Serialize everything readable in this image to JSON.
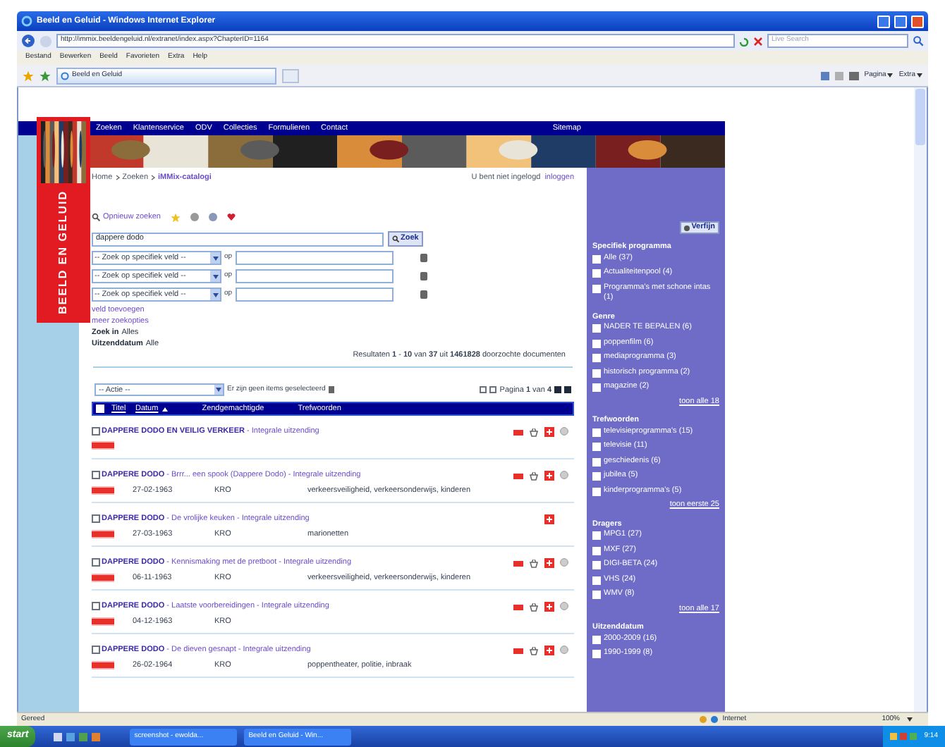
{
  "browser": {
    "title": "Beeld en Geluid - Windows Internet Explorer",
    "address": "http://immix.beeldengeluid.nl/extranet/index.aspx?ChapterID=1164",
    "search_placeholder": "Live Search",
    "menu": [
      "Bestand",
      "Bewerken",
      "Beeld",
      "Favorieten",
      "Extra",
      "Help"
    ],
    "tab": "Beeld en Geluid",
    "tools": [
      "Pagina",
      "Extra"
    ]
  },
  "site": {
    "logo_text": "BEELD EN GELUID",
    "nav": [
      "Zoeken",
      "Klantenservice",
      "ODV",
      "Collecties",
      "Formulieren",
      "Contact"
    ],
    "sitemap": "Sitemap",
    "breadcrumb": [
      "Home",
      "Zoeken",
      "iMMix-catalogi"
    ],
    "login_status": "U bent niet ingelogd",
    "login_link": "inloggen"
  },
  "search": {
    "again": "Opnieuw zoeken",
    "query": "dappere dodo",
    "button": "Zoek",
    "fields": [
      {
        "select": "-- Zoek op specifiek veld --",
        "op": "op"
      },
      {
        "select": "-- Zoek op specifiek veld --",
        "op": "op"
      },
      {
        "select": "-- Zoek op specifiek veld --",
        "op": "op"
      }
    ],
    "links": [
      "veld toevoegen",
      "meer zoekopties"
    ],
    "filters": [
      {
        "label": "Zoek in",
        "value": "Alles"
      },
      {
        "label": "Uitzenddatum",
        "value": "Alle"
      }
    ],
    "summary": "Resultaten **1** - **10** van **37** uit **1461828** doorzochte documenten"
  },
  "actions": {
    "select": "-- Actie --",
    "message": "Er zijn geen items geselecteerd",
    "pager": "Pagina **1** van **4**"
  },
  "table": {
    "select_all_checked": false,
    "columns": [
      "Titel",
      "Datum",
      "Zendgemachtigde",
      "Trefwoorden"
    ],
    "rows": [
      {
        "title": "DAPPERE DODO EN VEILIG VERKEER",
        "subtitle": "- Integrale uitzending",
        "checked": false,
        "preview": true,
        "basket": true,
        "add": true,
        "info": true
      },
      {
        "title": "DAPPERE DODO",
        "subtitle": "- Brrr... een spook (Dappere Dodo) - Integrale uitzending",
        "date": "27-02-1963",
        "broadcaster": "KRO",
        "keywords": "verkeersveiligheid, verkeersonderwijs, kinderen",
        "checked": false,
        "preview": true,
        "basket": true,
        "add": true,
        "info": true
      },
      {
        "title": "DAPPERE DODO",
        "subtitle": "- De vrolijke keuken - Integrale uitzending",
        "date": "27-03-1963",
        "broadcaster": "KRO",
        "keywords": "marionetten",
        "checked": false,
        "preview": false,
        "basket": false,
        "add": true,
        "info": false
      },
      {
        "title": "DAPPERE DODO",
        "subtitle": "- Kennismaking met de pretboot - Integrale uitzending",
        "date": "06-11-1963",
        "broadcaster": "KRO",
        "keywords": "verkeersveiligheid, verkeersonderwijs, kinderen",
        "checked": false,
        "preview": true,
        "basket": true,
        "add": true,
        "info": true
      },
      {
        "title": "DAPPERE DODO",
        "subtitle": "- Laatste voorbereidingen - Integrale uitzending",
        "date": "04-12-1963",
        "broadcaster": "KRO",
        "checked": false,
        "preview": true,
        "basket": true,
        "add": true,
        "info": true
      },
      {
        "title": "DAPPERE DODO",
        "subtitle": "- De dieven gesnapt - Integrale uitzending",
        "date": "26-02-1964",
        "broadcaster": "KRO",
        "keywords": "poppentheater, politie, inbraak",
        "checked": false,
        "preview": true,
        "basket": true,
        "add": true,
        "info": true
      }
    ]
  },
  "sidebar": {
    "button": "Verfijn",
    "groups": [
      {
        "title": "Specifiek programma",
        "items": [
          {
            "label": "Alle (37)",
            "checked": false
          },
          {
            "label": "Actualiteitenpool (4)",
            "checked": false
          },
          {
            "label": "Programma's met schone intas (1)",
            "checked": false
          }
        ]
      },
      {
        "title": "Genre",
        "items": [
          {
            "label": "NADER TE BEPALEN (6)",
            "checked": false
          },
          {
            "label": "poppenfilm (6)",
            "checked": false
          },
          {
            "label": "mediaprogramma (3)",
            "checked": false
          },
          {
            "label": "historisch programma (2)",
            "checked": false
          },
          {
            "label": "magazine (2)",
            "checked": false
          }
        ],
        "more": "toon alle 18"
      },
      {
        "title": "Trefwoorden",
        "items": [
          {
            "label": "televisieprogramma's (15)",
            "checked": false
          },
          {
            "label": "televisie (11)",
            "checked": false
          },
          {
            "label": "geschiedenis (6)",
            "checked": false
          },
          {
            "label": "jubilea (5)",
            "checked": false
          },
          {
            "label": "kinderprogramma's (5)",
            "checked": false
          }
        ],
        "more": "toon eerste 25"
      },
      {
        "title": "Dragers",
        "items": [
          {
            "label": "MPG1 (27)",
            "checked": false
          },
          {
            "label": "MXF (27)",
            "checked": false
          },
          {
            "label": "DIGI-BETA (24)",
            "checked": false
          },
          {
            "label": "VHS (24)",
            "checked": false
          },
          {
            "label": "WMV (8)",
            "checked": false
          }
        ],
        "more": "toon alle 17"
      },
      {
        "title": "Uitzenddatum",
        "items": [
          {
            "label": "2000-2009 (16)",
            "checked": false
          },
          {
            "label": "1990-1999 (8)",
            "checked": false
          }
        ]
      }
    ]
  },
  "status_bar": {
    "text": "Gereed",
    "zone": "Internet",
    "zoom": "100%"
  },
  "taskbar": {
    "start": "start",
    "tasks": [
      "screenshot - ewolda...",
      "Beeld en Geluid - Win..."
    ],
    "clock": "9:14"
  }
}
